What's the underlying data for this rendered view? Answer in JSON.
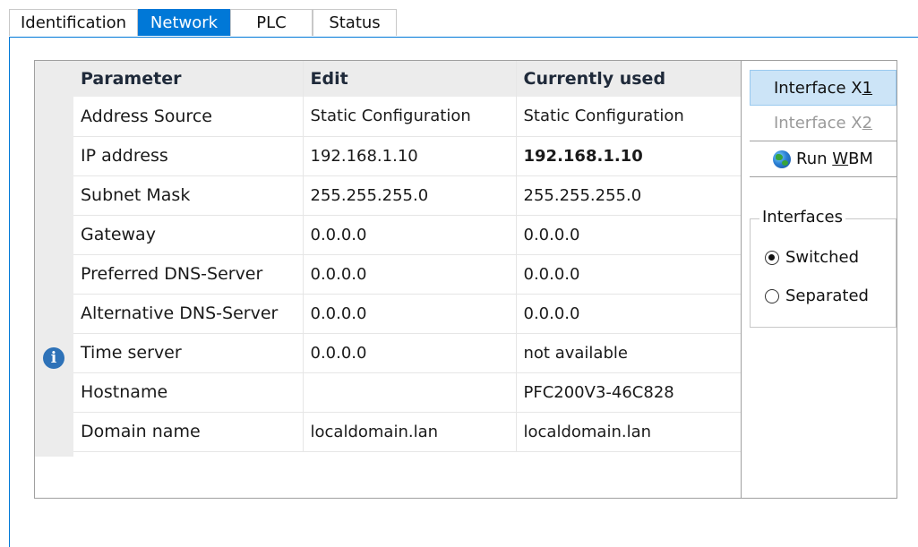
{
  "tabs": [
    {
      "label": "Identification",
      "active": false
    },
    {
      "label": "Network",
      "active": true
    },
    {
      "label": "PLC",
      "active": false
    },
    {
      "label": "Status",
      "active": false
    }
  ],
  "table": {
    "headers": {
      "parameter": "Parameter",
      "edit": "Edit",
      "used": "Currently used"
    },
    "rows": [
      {
        "parameter": "Address Source",
        "edit": "Static Configuration",
        "used": "Static Configuration"
      },
      {
        "parameter": "IP address",
        "edit": "192.168.1.10",
        "used": "192.168.1.10"
      },
      {
        "parameter": "Subnet Mask",
        "edit": "255.255.255.0",
        "used": "255.255.255.0"
      },
      {
        "parameter": "Gateway",
        "edit": "0.0.0.0",
        "used": "0.0.0.0"
      },
      {
        "parameter": "Preferred DNS-Server",
        "edit": "0.0.0.0",
        "used": "0.0.0.0"
      },
      {
        "parameter": "Alternative DNS-Server",
        "edit": "0.0.0.0",
        "used": "0.0.0.0"
      },
      {
        "parameter": "Time server",
        "edit": "0.0.0.0",
        "used": "not available"
      },
      {
        "parameter": "Hostname",
        "edit": "",
        "used": "PFC200V3-46C828"
      },
      {
        "parameter": "Domain name",
        "edit": "localdomain.lan",
        "used": "localdomain.lan"
      }
    ]
  },
  "info_icon": "info-icon",
  "side": {
    "interface_x1": {
      "text": "Interface X",
      "key": "1"
    },
    "interface_x2": {
      "text": "Interface X",
      "key": "2"
    },
    "run_wbm": {
      "pre": "Run ",
      "key": "W",
      "post": "BM"
    }
  },
  "interfaces": {
    "legend": "Interfaces",
    "options": [
      {
        "label": "Switched",
        "selected": true
      },
      {
        "label": "Separated",
        "selected": false
      }
    ]
  },
  "colors": {
    "accent": "#0078d7",
    "selected_button": "#cce4f7"
  }
}
